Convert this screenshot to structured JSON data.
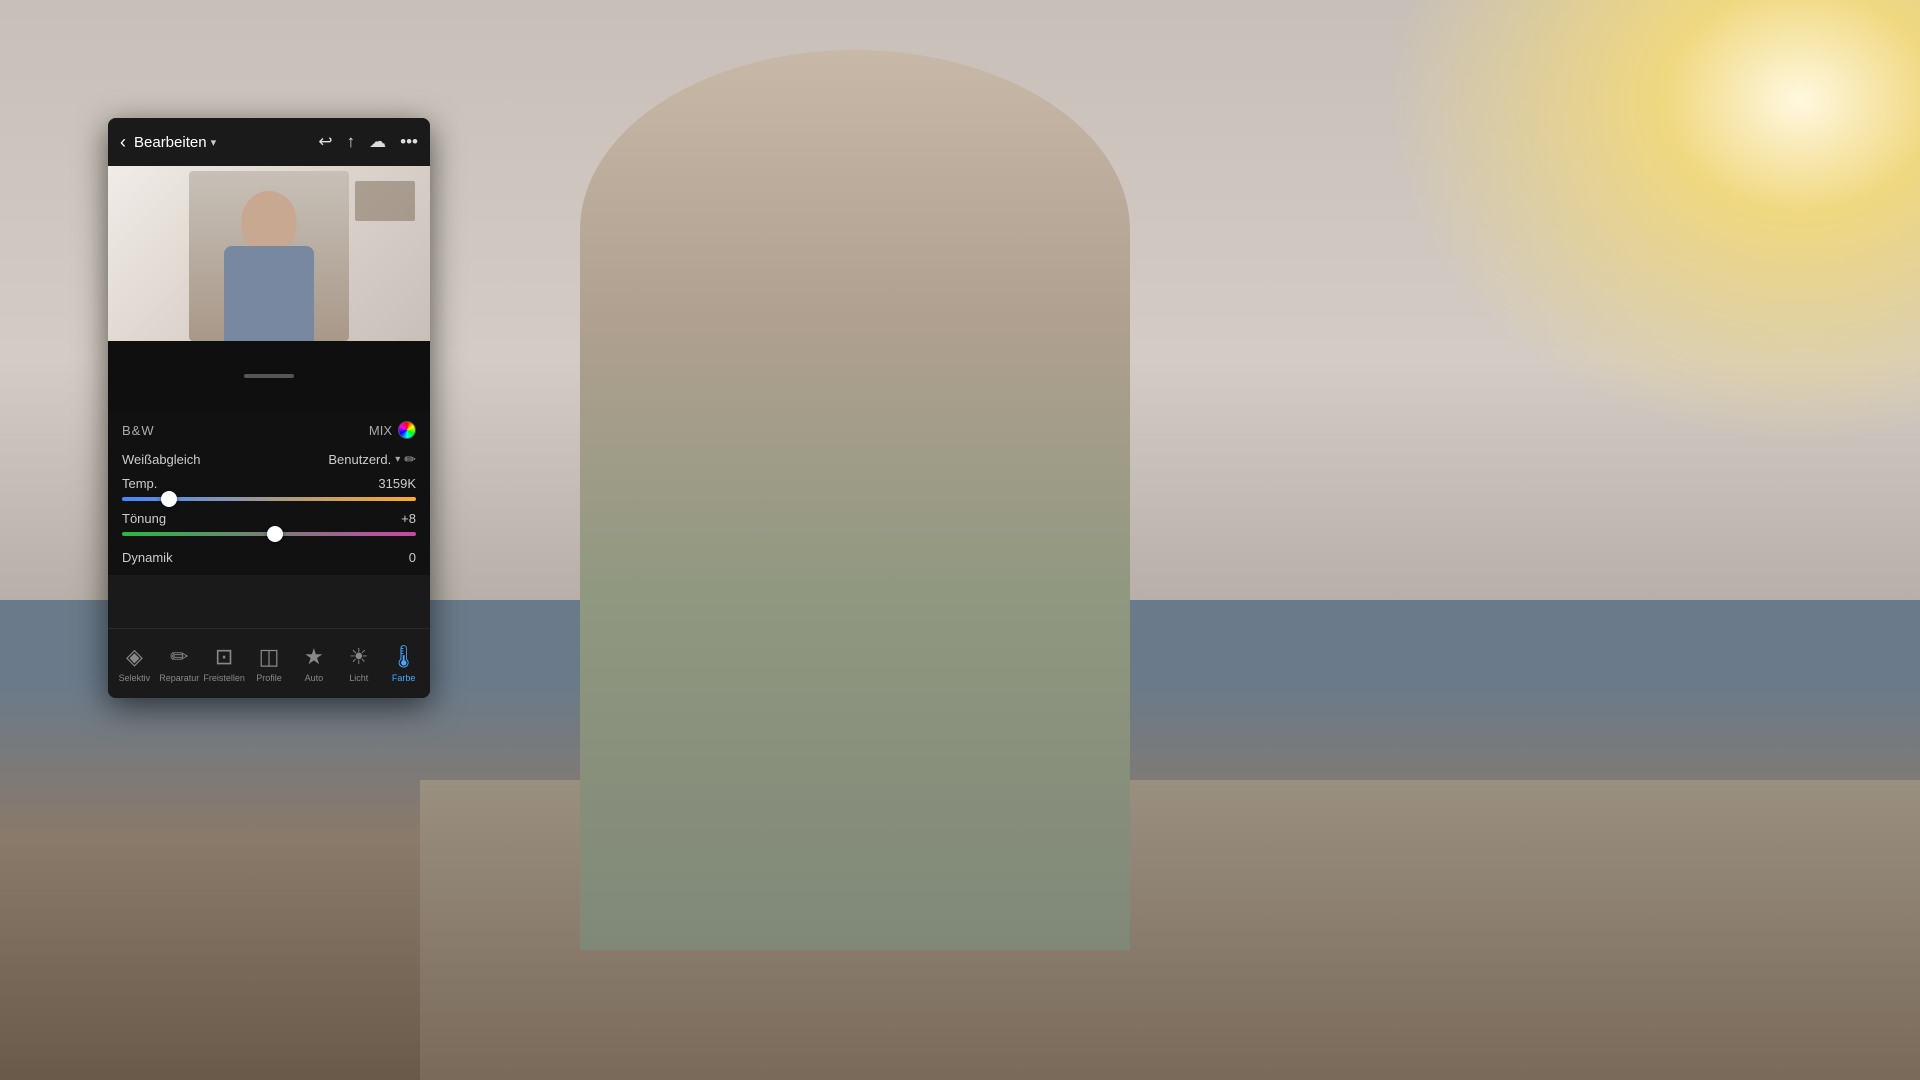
{
  "background": {
    "color": "#8a9bb0"
  },
  "phone": {
    "topBar": {
      "title": "Bearbeiten",
      "backLabel": "‹",
      "dropdownArrow": "▾",
      "icons": [
        "↩",
        "↑",
        "☁",
        "•••"
      ]
    },
    "bwMix": {
      "bwLabel": "B&W",
      "mixLabel": "MIX"
    },
    "weissabgleich": {
      "label": "Weißabgleich",
      "value": "Benutzerd.",
      "chevron": "▾"
    },
    "temp": {
      "label": "Temp.",
      "value": "3159K",
      "thumbPercent": 16
    },
    "tonung": {
      "label": "Tönung",
      "value": "+8",
      "thumbPercent": 52
    },
    "dynamik": {
      "label": "Dynamik",
      "value": "0"
    },
    "toolbar": {
      "items": [
        {
          "id": "selektiv",
          "label": "Selektiv",
          "icon": "◈",
          "active": false
        },
        {
          "id": "reparatur",
          "label": "Reparatur",
          "icon": "✏",
          "active": false
        },
        {
          "id": "freistellen",
          "label": "Freistellen",
          "icon": "⊡",
          "active": false
        },
        {
          "id": "profile",
          "label": "Profile",
          "icon": "◫",
          "active": false
        },
        {
          "id": "auto",
          "label": "Auto",
          "icon": "★",
          "active": false
        },
        {
          "id": "licht",
          "label": "Licht",
          "icon": "☀",
          "active": false
        },
        {
          "id": "farbe",
          "label": "Farbe",
          "icon": "🌡",
          "active": true
        }
      ]
    }
  }
}
